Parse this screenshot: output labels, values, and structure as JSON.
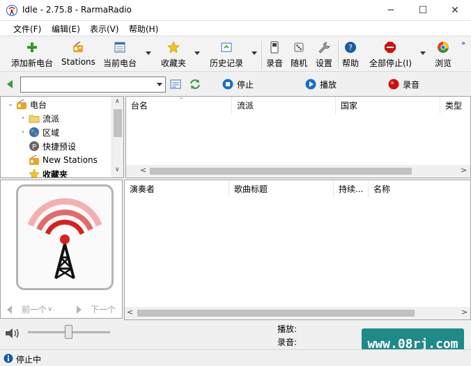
{
  "window": {
    "title": "Idle - 2.75.8 - RarmaRadio",
    "minimize": "─",
    "maximize": "☐",
    "close": "✕"
  },
  "menu": [
    "文件(F)",
    "编辑(E)",
    "表示(V)",
    "帮助(H)"
  ],
  "toolbar": {
    "add_station": "添加新电台",
    "stations": "Stations",
    "current_station": "当前电台",
    "favorites": "收藏夹",
    "history": "历史记录",
    "record": "录音",
    "random": "随机",
    "settings": "设置",
    "help": "帮助",
    "stop_all": "全部停止(I)",
    "browse": "浏览",
    "more": "»"
  },
  "controls": {
    "station_input_value": "",
    "stop": "停止",
    "play": "播放",
    "record": "录音"
  },
  "tree": {
    "items": [
      {
        "label": "电台",
        "expander": "⌄",
        "icon": "radio-icon"
      },
      {
        "label": "流派",
        "expander": "›",
        "icon": "folder-icon"
      },
      {
        "label": "区域",
        "expander": "›",
        "icon": "globe-icon"
      },
      {
        "label": "快捷预设",
        "expander": "",
        "icon": "preset-icon"
      },
      {
        "label": "New Stations",
        "expander": "",
        "icon": "radio-icon"
      },
      {
        "label": "收藏夹",
        "expander": "",
        "icon": "star-icon"
      }
    ],
    "scroll_up": "∧",
    "scroll_down": "∨"
  },
  "station_list": {
    "columns": [
      "台名",
      "流派",
      "国家",
      "类型"
    ],
    "sort_indicator": "^",
    "scroll_left": "<",
    "scroll_right": ">"
  },
  "track_list": {
    "columns": [
      "演奏者",
      "歌曲标题",
      "持续...",
      "名称"
    ],
    "scroll_left": "<",
    "scroll_right": ">"
  },
  "logo_nav": {
    "prev": "前一个",
    "prev_arrow": "∨",
    "next": "下一个"
  },
  "info": {
    "playing_label": "播放:",
    "recording_label": "录音:"
  },
  "watermark": "www.08rj.com",
  "status": {
    "text": "停止中"
  },
  "colors": {
    "accent_green": "#3a9a3a",
    "stop_blue": "#1a6fc4",
    "record_red": "#d01010",
    "watermark_bg": "#1f8a88"
  }
}
